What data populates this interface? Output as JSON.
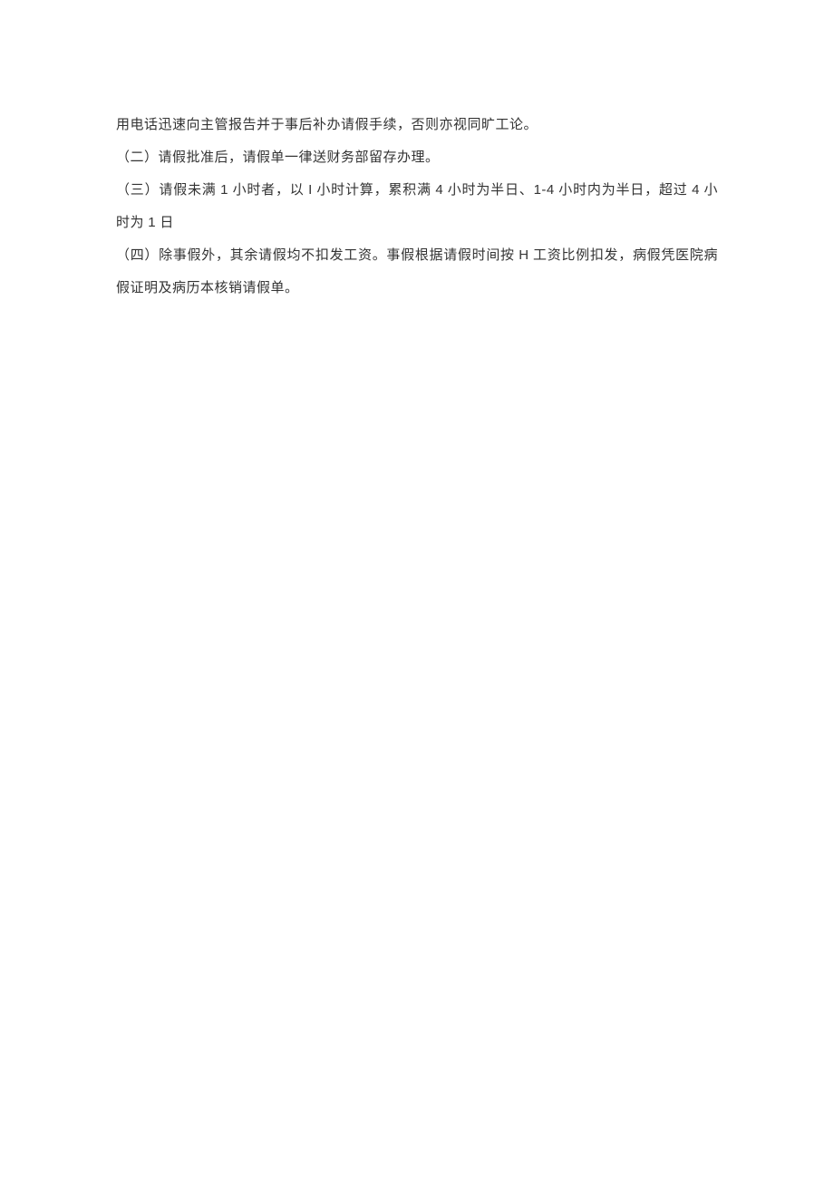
{
  "paragraphs": {
    "p1": "用电话迅速向主管报告并于事后补办请假手续，否则亦视同旷工论。",
    "p2": "（二）请假批准后，请假单一律送财务部留存办理。",
    "p3_part1": "（三）请假未满 ",
    "p3_num1": "1",
    "p3_part2": " 小时者，以 ",
    "p3_num2": "I",
    "p3_part3": " 小时计算，累积满 ",
    "p3_num3": "4",
    "p3_part4": " 小时为半日、",
    "p3_num4": "1-4",
    "p3_part5": " 小时内为半日，超过 ",
    "p3_num5": "4",
    "p3_part6": " 小时为 ",
    "p3_num6": "1",
    "p3_part7": " 日",
    "p4_part1": "（四）除事假外，其余请假均不扣发工资。事假根据请假时间按 ",
    "p4_h": "H",
    "p4_part2": " 工资比例扣发，病假凭医院病假证明及病历本核销请假单。"
  }
}
